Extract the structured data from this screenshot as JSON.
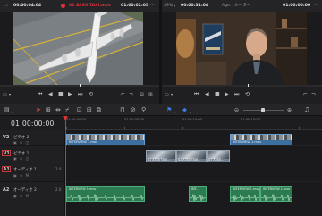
{
  "left_viewer": {
    "src_timecode": "00:00:04:04",
    "clip_name": "01 A380 TAXI.mov",
    "rec_timecode": "01:00:02:05",
    "colors": {
      "clip_name": "#e0303a"
    }
  },
  "right_viewer": {
    "zoom": "39%",
    "timecode_a": "00:00:31:04",
    "title": "Age... ",
    "title_tail": "ルーター",
    "timecode_b": "01:00:00:00"
  },
  "timeline": {
    "timecode": "01:00:00:00",
    "ruler": [
      "01:00:00:00",
      "01:00:05:00",
      "01:00:10:00",
      "01:00:15:00"
    ],
    "tracks": [
      {
        "id": "V2",
        "name": "ビデオ 2",
        "icons": "▣ ⊙ ◫",
        "count": ""
      },
      {
        "id": "V1",
        "name": "ビデオ 1",
        "icons": "▣ ⊙ ◫",
        "count": ""
      },
      {
        "id": "A1",
        "name": "オーディオ 1",
        "icons": "▣ ⊙ M",
        "count": "2.0"
      },
      {
        "id": "A2",
        "name": "オーディオ 2",
        "icons": "▣ ⊙ M",
        "count": "2.0"
      }
    ],
    "clips": {
      "v2a": "INTERVIEW 1.mov",
      "v2b": "INTERVIEW 1.mov",
      "v1a": "01 A380 TAXI...",
      "v1b": "02 A380 TAXI...",
      "v1c": "03 A380...",
      "a2a": "INTERVIEW 1.mov",
      "a2b": "INT...",
      "a2c": "INTERVIEW 1.mov",
      "a2d": "INTERVIEW 1.mov"
    }
  },
  "colors": {
    "video_clip": "#3b6fa0",
    "audio_clip": "#2c7a4f",
    "playhead": "#e03131"
  }
}
